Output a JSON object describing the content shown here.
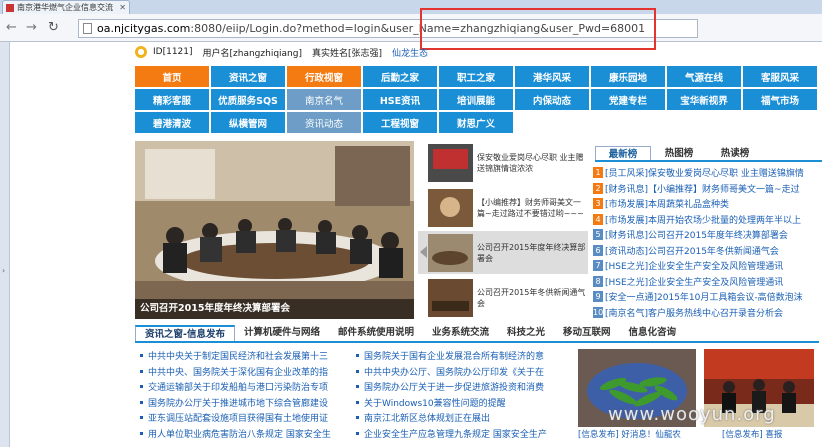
{
  "browser": {
    "tab_title": "南京港华燃气企业信息交流",
    "url_host": "oa.njcitygas.com",
    "url_rest": ":8080/eiip/Login.do?method=login&user_Name=zhangzhiqiang&user_Pwd=68001",
    "highlight_color": "#e3342f"
  },
  "user": {
    "id": "ID[1121]",
    "username": "用户名[zhangzhiqiang]",
    "realname": "真实姓名[张志强]",
    "link": "仙龙生态"
  },
  "nav": {
    "rows": [
      [
        {
          "label": "首页",
          "style": "orange"
        },
        {
          "label": "资讯之窗",
          "style": "blue"
        },
        {
          "label": "行政视窗",
          "style": "orange"
        },
        {
          "label": "后勤之家",
          "style": "blue"
        },
        {
          "label": "职工之家",
          "style": "blue"
        },
        {
          "label": "港华风采",
          "style": "blue"
        },
        {
          "label": "康乐园地",
          "style": "blue"
        },
        {
          "label": "气源在线",
          "style": "blue"
        },
        {
          "label": "客服风采",
          "style": "blue"
        }
      ],
      [
        {
          "label": "精彩客服",
          "style": "blue"
        },
        {
          "label": "优质服务SQS",
          "style": "blue"
        },
        {
          "label": "南京名气",
          "style": "gray"
        },
        {
          "label": "HSE资讯",
          "style": "blue"
        },
        {
          "label": "培训展能",
          "style": "blue"
        },
        {
          "label": "内保动态",
          "style": "blue"
        },
        {
          "label": "党建专栏",
          "style": "blue"
        },
        {
          "label": "宝华新视界",
          "style": "blue"
        },
        {
          "label": "福气市场",
          "style": "blue"
        }
      ],
      [
        {
          "label": "碧港清波",
          "style": "blue"
        },
        {
          "label": "纵横管网",
          "style": "blue"
        },
        {
          "label": "资讯动态",
          "style": "gray"
        },
        {
          "label": "工程视窗",
          "style": "blue"
        },
        {
          "label": "财思广义",
          "style": "blue"
        }
      ]
    ]
  },
  "slideshow": {
    "caption": "公司召开2015年度年终决算部署会",
    "thumbs": [
      {
        "text": "保安敬业爱岗尽心尽职 业主赠送锦旗情谊浓浓"
      },
      {
        "text": "【小编推荐】财务师哥美文一篇~走过路过不要错过哟~~~"
      },
      {
        "text": "公司召开2015年度年终决算部署会"
      },
      {
        "text": "公司召开2015年冬供新闻通气会"
      }
    ]
  },
  "ranking": {
    "tabs": [
      "最新榜",
      "热图榜",
      "热读榜"
    ],
    "items": [
      {
        "num": "1",
        "cat": "[员工风采]",
        "text": "保安敬业爱岗尽心尽职 业主赠送锦旗情"
      },
      {
        "num": "2",
        "cat": "[财务讯息]",
        "text": "【小编推荐】财务师哥美文一篇~走过"
      },
      {
        "num": "3",
        "cat": "[市场发展]",
        "text": "本周蔬菜礼品盒种类"
      },
      {
        "num": "4",
        "cat": "[市场发展]",
        "text": "本周开始农场少批量的处理两年半以上"
      },
      {
        "num": "5",
        "cat": "[财务讯息]",
        "text": "公司召开2015年度年终决算部署会"
      },
      {
        "num": "6",
        "cat": "[资讯动态]",
        "text": "公司召开2015年冬供新闻通气会"
      },
      {
        "num": "7",
        "cat": "[HSE之光]",
        "text": "企业安全生产安全及风险管理通讯"
      },
      {
        "num": "8",
        "cat": "[HSE之光]",
        "text": "企业安全生产安全及风险管理通讯"
      },
      {
        "num": "9",
        "cat": "[安全一点通]",
        "text": "2015年10月工具箱会议-高倍数泡沫"
      },
      {
        "num": "10",
        "cat": "[南京名气]",
        "text": "客户服务热线中心召开录音分析会"
      }
    ]
  },
  "bottom": {
    "tabs": [
      "资讯之窗-信息发布",
      "计算机硬件与网络",
      "邮件系统使用说明",
      "业务系统交流",
      "科技之光",
      "移动互联网",
      "信息化咨询"
    ],
    "col1": [
      "中共中央关于制定国民经济和社会发展第十三",
      "中共中央、国务院关于深化国有企业改革的指",
      "交通运输部关于印发船舶与港口污染防治专项",
      "国务院办公厅关于推进城市地下综合管廊建设",
      "亚东调压站配套设施项目获得国有土地使用证",
      "用人单位职业病危害防治八条规定 国家安全生"
    ],
    "col2": [
      "国务院关于国有企业发展混合所有制经济的意",
      "中共中央办公厅、国务院办公厅印发《关于在",
      "国务院办公厅关于进一步促进旅游投资和消费",
      "关于Windows10兼容性问题的提醒",
      "南京江北新区总体规划正在展出",
      "企业安全生产应急管理九条规定 国家安全生产"
    ],
    "photo_caption_1": "[信息发布] 好消息！仙龍农",
    "photo_caption_2": "[信息发布] 喜报"
  },
  "watermark": "www.wooyun.org",
  "colors": {
    "nav_blue": "#1b8fd6",
    "nav_orange": "#f47a12",
    "nav_gray": "#6e9ec7",
    "link_blue": "#1a5fb4"
  }
}
